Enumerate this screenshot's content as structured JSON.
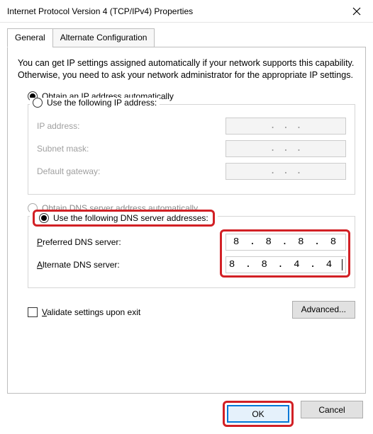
{
  "window": {
    "title": "Internet Protocol Version 4 (TCP/IPv4) Properties"
  },
  "tabs": {
    "general": "General",
    "alternate": "Alternate Configuration"
  },
  "intro": "You can get IP settings assigned automatically if your network supports this capability. Otherwise, you need to ask your network administrator for the appropriate IP settings.",
  "ip": {
    "auto_label_pre": "O",
    "auto_label_post": "btain an IP address automatically",
    "manual_label_pre": "Use the following IP address:",
    "fields": {
      "ip_address": "IP address:",
      "subnet_mask": "Subnet mask:",
      "default_gateway": "Default gateway:"
    }
  },
  "dns": {
    "auto_label": "Obtain DNS server address automatically",
    "manual_label": "Use the following DNS server addresses:",
    "preferred_label": "Preferred DNS server:",
    "alternate_label": "Alternate DNS server:",
    "preferred_value": "8 . 8 . 8 . 8",
    "alternate_value": "8 . 8 . 4 . 4"
  },
  "validate_label": "Validate settings upon exit",
  "advanced_label": "Advanced...",
  "buttons": {
    "ok": "OK",
    "cancel": "Cancel"
  }
}
